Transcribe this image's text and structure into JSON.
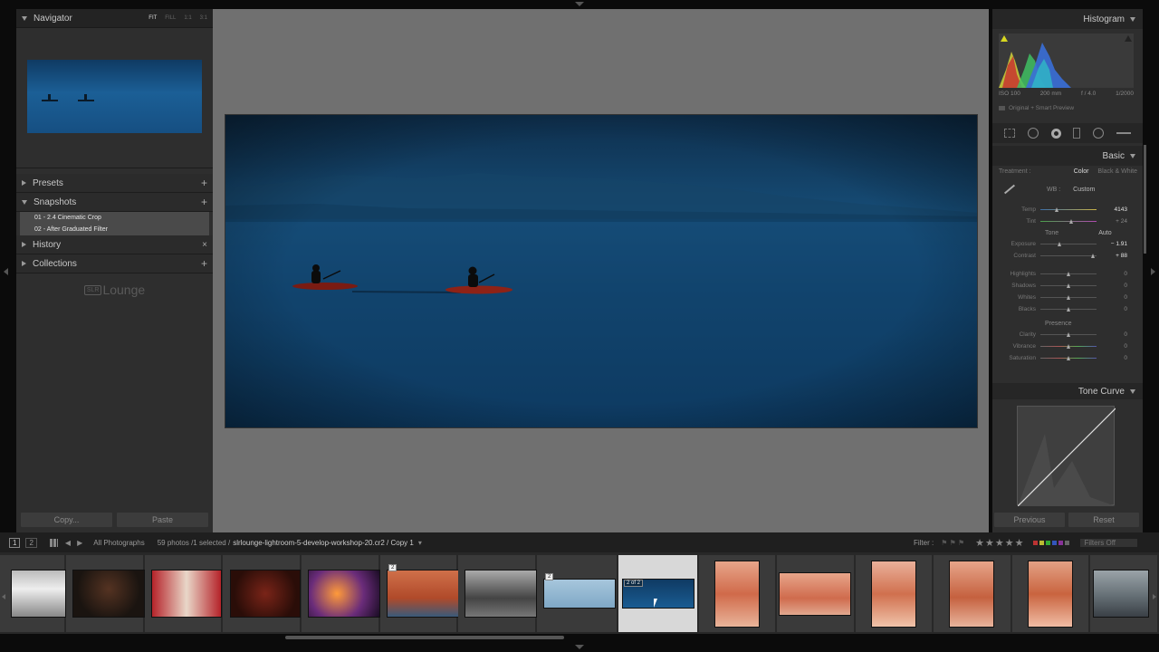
{
  "navigator": {
    "title": "Navigator",
    "options": [
      "FIT",
      "FILL",
      "1:1",
      "3:1"
    ]
  },
  "left_panels": {
    "presets": "Presets",
    "snapshots": "Snapshots",
    "snapshot_items": [
      "01 - 2.4 Cinematic Crop",
      "02 - After Graduated Filter"
    ],
    "history": "History",
    "collections": "Collections",
    "watermark": "Lounge",
    "watermark_box": "SLR"
  },
  "buttons": {
    "copy": "Copy...",
    "paste": "Paste",
    "previous": "Previous",
    "reset": "Reset"
  },
  "histogram": {
    "title": "Histogram",
    "iso": "ISO 100",
    "focal": "200 mm",
    "aperture": "f / 4.0",
    "shutter": "1/2000",
    "preview_status": "Original + Smart Preview"
  },
  "basic": {
    "title": "Basic",
    "treatment_label": "Treatment :",
    "treatment_color": "Color",
    "treatment_bw": "Black & White",
    "wb_label": "WB :",
    "wb_value": "Custom",
    "temp": {
      "label": "Temp",
      "value": "4143"
    },
    "tint": {
      "label": "Tint",
      "value": "+ 24"
    },
    "tone_label": "Tone",
    "auto_label": "Auto",
    "exposure": {
      "label": "Exposure",
      "value": "− 1.91"
    },
    "contrast": {
      "label": "Contrast",
      "value": "+ 88"
    },
    "highlights": {
      "label": "Highlights",
      "value": "0"
    },
    "shadows": {
      "label": "Shadows",
      "value": "0"
    },
    "whites": {
      "label": "Whites",
      "value": "0"
    },
    "blacks": {
      "label": "Blacks",
      "value": "0"
    },
    "presence_label": "Presence",
    "clarity": {
      "label": "Clarity",
      "value": "0"
    },
    "vibrance": {
      "label": "Vibrance",
      "value": "0"
    },
    "saturation": {
      "label": "Saturation",
      "value": "0"
    }
  },
  "tone_curve": {
    "title": "Tone Curve"
  },
  "filmstrip_bar": {
    "page1": "1",
    "page2": "2",
    "source": "All Photographs",
    "count": "59 photos /1 selected /",
    "filename": "slrlounge-lightroom-5-develop-workshop-20.cr2 / Copy 1",
    "filter_label": "Filter :",
    "filters_off": "Filters Off"
  },
  "filmstrip": {
    "badge_stack": "2",
    "badge_virtual": "2",
    "badge_selected": "2 of 2"
  },
  "colors": {
    "panel_bg": "#2e2e2e",
    "center_bg": "#707070",
    "photo_blue": "#174f7a",
    "selected_cell": "#d8d8d8"
  }
}
